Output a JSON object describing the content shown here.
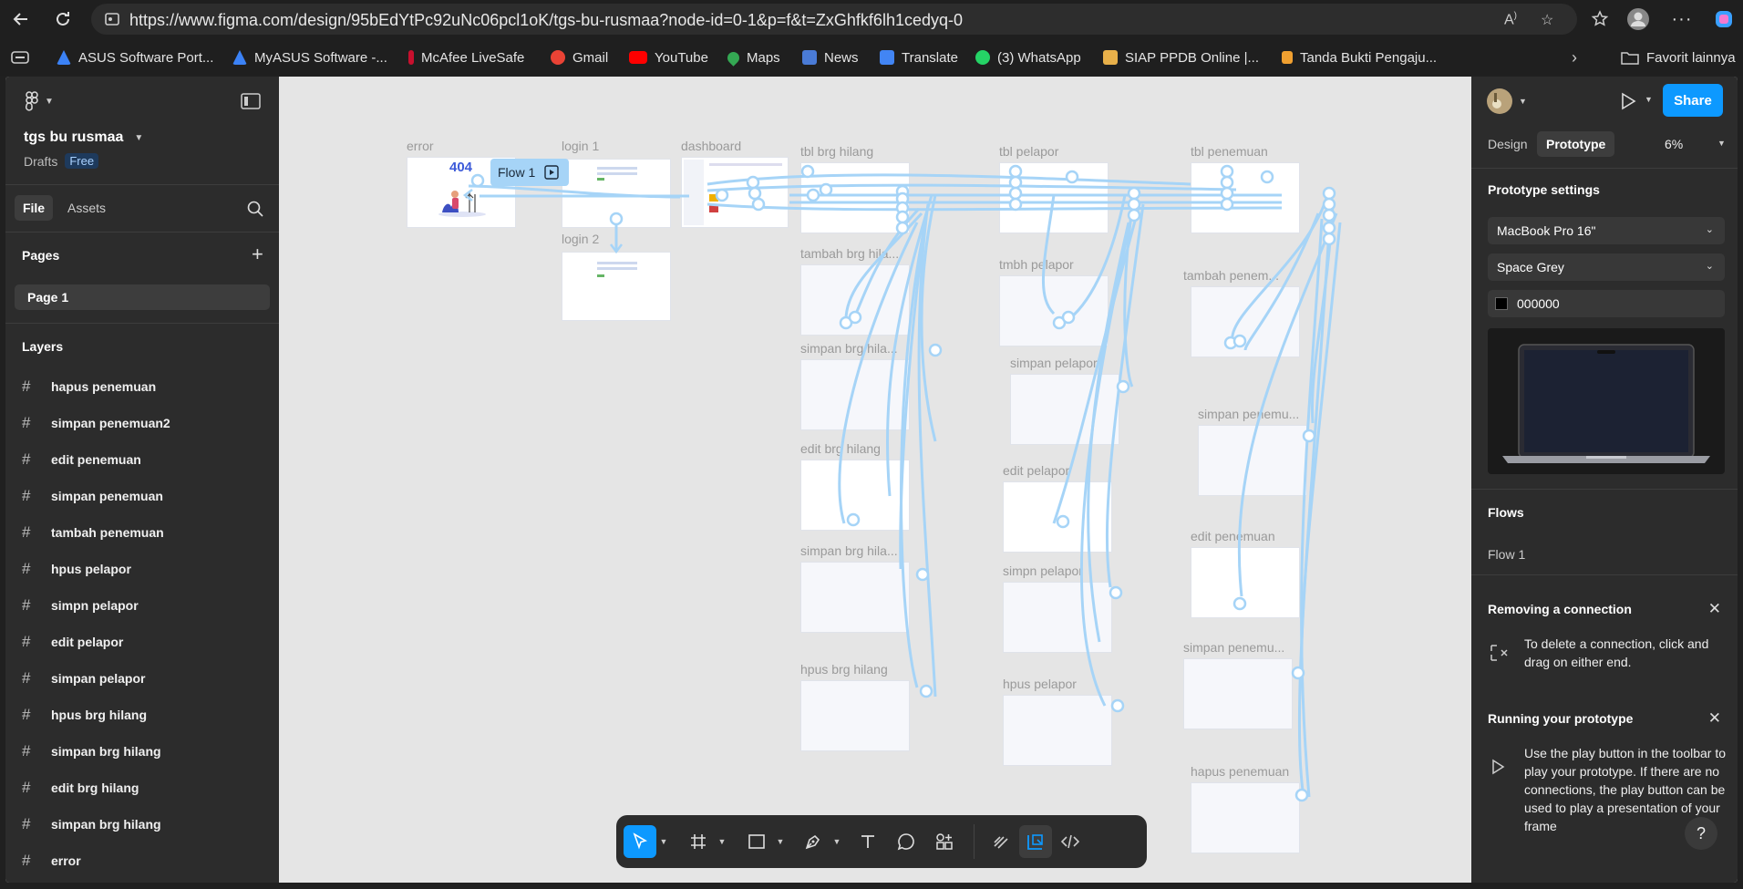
{
  "browser": {
    "url": "https://www.figma.com/design/95bEdYtPc92uNc06pcl1oK/tgs-bu-rusmaa?node-id=0-1&p=f&t=ZxGhfkf6lh1cedyq-0",
    "bookmarks": [
      {
        "label": "ASUS Software Port...",
        "color": "#3b82f6"
      },
      {
        "label": "MyASUS Software -...",
        "color": "#3b82f6"
      },
      {
        "label": "McAfee LiveSafe",
        "color": "#c8102e"
      },
      {
        "label": "Gmail",
        "color": "#ea4335"
      },
      {
        "label": "YouTube",
        "color": "#ff0000"
      },
      {
        "label": "Maps",
        "color": "#34a853"
      },
      {
        "label": "News",
        "color": "#4a7bd6"
      },
      {
        "label": "Translate",
        "color": "#4285f4"
      },
      {
        "label": "(3) WhatsApp",
        "color": "#25d366"
      },
      {
        "label": "SIAP PPDB Online |...",
        "color": "#e8b04a"
      },
      {
        "label": "Tanda Bukti Pengaju...",
        "color": "#f0a030"
      }
    ],
    "other_bookmarks": "Favorit lainnya"
  },
  "left_panel": {
    "file_name": "tgs bu rusmaa",
    "drafts": "Drafts",
    "badge": "Free",
    "tab_file": "File",
    "tab_assets": "Assets",
    "pages_title": "Pages",
    "current_page": "Page 1",
    "layers_title": "Layers",
    "layers": [
      "hapus penemuan",
      "simpan penemuan2",
      "edit penemuan",
      "simpan penemuan",
      "tambah penemuan",
      "hpus pelapor",
      "simpn pelapor",
      "edit pelapor",
      "simpan pelapor",
      "hpus brg hilang",
      "simpan brg hilang",
      "edit brg hilang",
      "simpan brg hilang",
      "error"
    ]
  },
  "canvas": {
    "flow_label": "Flow 1",
    "error_code": "404",
    "frames": [
      {
        "label": "error"
      },
      {
        "label": "login 1"
      },
      {
        "label": "login 2"
      },
      {
        "label": "dashboard"
      },
      {
        "label": "tbl brg hilang"
      },
      {
        "label": "tambah brg hila..."
      },
      {
        "label": "simpan brg hila..."
      },
      {
        "label": "edit brg hilang"
      },
      {
        "label": "simpan brg hila..."
      },
      {
        "label": "hpus brg hilang"
      },
      {
        "label": "tbl pelapor"
      },
      {
        "label": "tmbh pelapor"
      },
      {
        "label": "simpan pelapor"
      },
      {
        "label": "edit pelapor"
      },
      {
        "label": "simpn pelapor"
      },
      {
        "label": "hpus pelapor"
      },
      {
        "label": "tbl penemuan"
      },
      {
        "label": "tambah penem..."
      },
      {
        "label": "simpan penemu..."
      },
      {
        "label": "edit penemuan"
      },
      {
        "label": "simpan penemu..."
      },
      {
        "label": "hapus penemuan"
      }
    ]
  },
  "right_panel": {
    "tab_design": "Design",
    "tab_prototype": "Prototype",
    "zoom": "6%",
    "share": "Share",
    "settings_title": "Prototype settings",
    "device": "MacBook Pro 16\"",
    "model": "Space Grey",
    "bg_color": "000000",
    "flows_title": "Flows",
    "flow_item": "Flow 1",
    "removing_title": "Removing a connection",
    "removing_text": "To delete a connection, click and drag on either end.",
    "running_title": "Running your prototype",
    "running_text": "Use the play button in the toolbar to play your prototype. If there are no connections, the play button can be used to play a presentation of your frame",
    "help": "?"
  },
  "colors": {
    "accent": "#0d99ff",
    "connector": "#a6d4f7",
    "panel_bg": "#2c2c2c"
  }
}
